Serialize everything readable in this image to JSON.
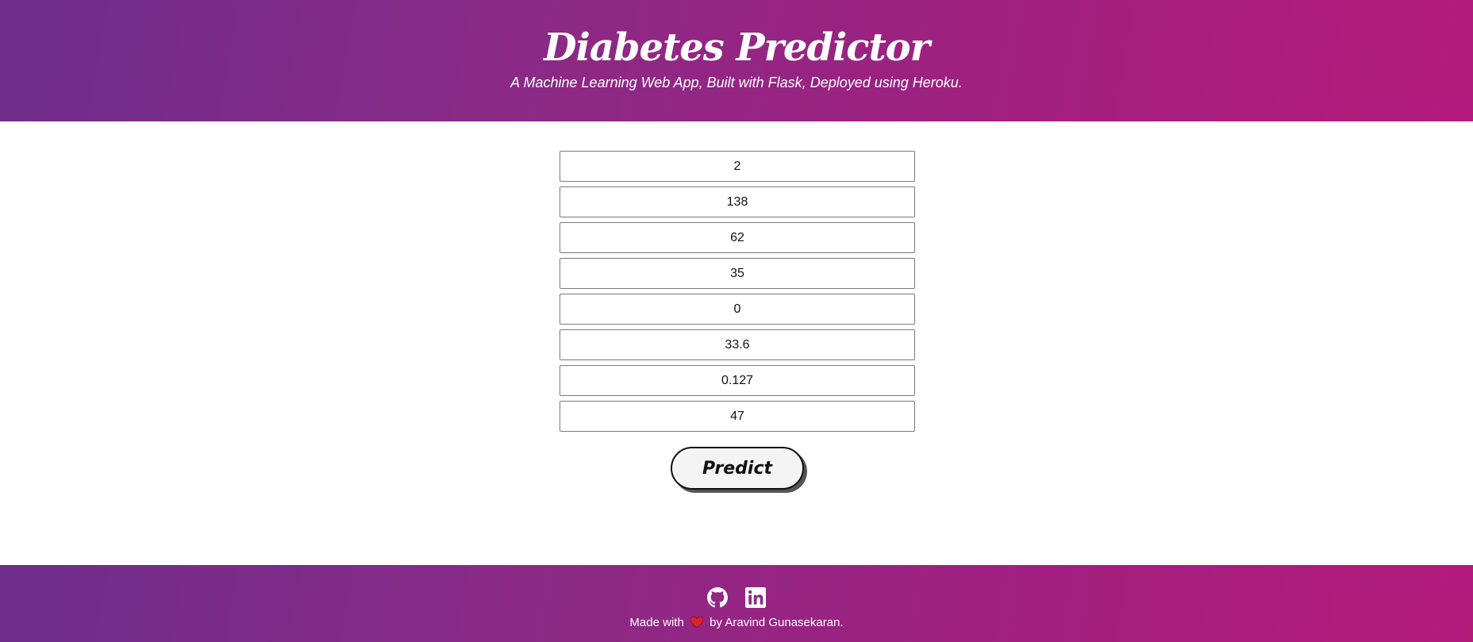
{
  "header": {
    "title": "Diabetes Predictor",
    "subtitle": "A Machine Learning Web App, Built with Flask, Deployed using Heroku."
  },
  "form": {
    "fields": [
      "2",
      "138",
      "62",
      "35",
      "0",
      "33.6",
      "0.127",
      "47"
    ],
    "submit_label": "Predict"
  },
  "footer": {
    "icons": [
      "github-icon",
      "linkedin-icon"
    ],
    "made_with": "Made with",
    "heart_icon": "heart-icon",
    "by_text": "by Aravind Gunasekaran."
  },
  "colors": {
    "gradient_start": "#6f2d8c",
    "gradient_end": "#b31b7b",
    "heart": "#e0212b"
  }
}
